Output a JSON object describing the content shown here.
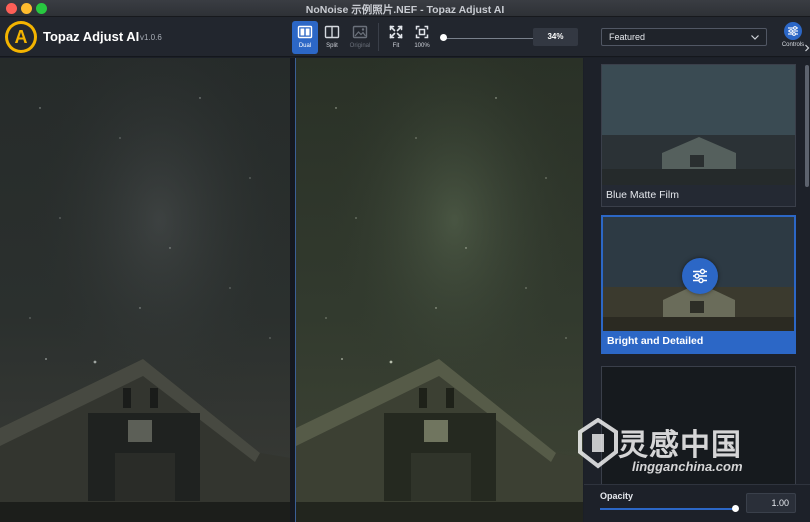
{
  "window": {
    "title": "NoNoise 示例照片.NEF - Topaz Adjust AI"
  },
  "app": {
    "logo_letter": "A",
    "name": "Topaz Adjust AI",
    "version": "v1.0.6"
  },
  "toolbar": {
    "view_modes": [
      {
        "label": "Dual",
        "icon": "dual-view-icon",
        "active": true
      },
      {
        "label": "Split",
        "icon": "split-view-icon",
        "active": false
      },
      {
        "label": "Original",
        "icon": "original-view-icon",
        "active": false,
        "disabled": true
      }
    ],
    "fit_label": "Fit",
    "actual_size_label": "100%",
    "zoom_value": "34%"
  },
  "sidebar": {
    "category": "Featured",
    "controls_label": "Controls",
    "presets": [
      {
        "label": "Blue Matte Film",
        "selected": false
      },
      {
        "label": "Bright and Detailed",
        "selected": true
      },
      {
        "label": "",
        "selected": false
      }
    ],
    "opacity": {
      "label": "Opacity",
      "value": "1.00",
      "level": 1.0
    }
  },
  "watermark": {
    "text": "灵感中国",
    "url": "lingganchina.com"
  },
  "colors": {
    "accent": "#2c67c6",
    "logo": "#f4b400"
  }
}
